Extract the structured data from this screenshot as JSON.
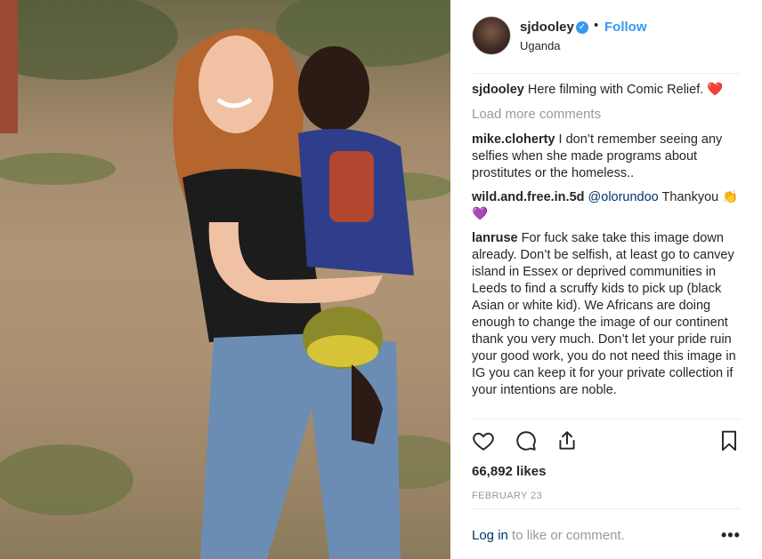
{
  "post": {
    "username": "sjdooley",
    "verified_icon": "verified-badge-icon",
    "separator": "•",
    "follow_label": "Follow",
    "location": "Uganda"
  },
  "comments": {
    "caption": {
      "user": "sjdooley",
      "text": "Here filming with Comic Relief. ❤️"
    },
    "load_more": "Load more comments",
    "items": [
      {
        "user": "mike.cloherty",
        "text": "I don’t remember seeing any selfies when she made programs about prostitutes or the homeless.."
      },
      {
        "user": "wild.and.free.in.5d",
        "mention": "@olorundoo",
        "text": "Thankyou 👏💜"
      },
      {
        "user": "lanruse",
        "text": "For fuck sake take this image down already. Don’t be selfish, at least go to canvey island in Essex or deprived communities in Leeds to find a scruffy kids to pick up (black Asian or white kid). We Africans are doing enough to change the image of our continent thank you very much. Don’t let your pride ruin your good work, you do not need this image in IG you can keep it for your private collection if your intentions are noble."
      }
    ]
  },
  "actions": {
    "like_icon": "heart-icon",
    "comment_icon": "comment-bubble-icon",
    "share_icon": "share-icon",
    "save_icon": "bookmark-icon"
  },
  "stats": {
    "likes": "66,892 likes",
    "date": "FEBRUARY 23"
  },
  "footer": {
    "login_link": "Log in",
    "login_rest": " to like or comment.",
    "more": "•••"
  },
  "colors": {
    "link_blue": "#3897f0",
    "text": "#262626",
    "muted": "#999999",
    "mention": "#003569"
  }
}
